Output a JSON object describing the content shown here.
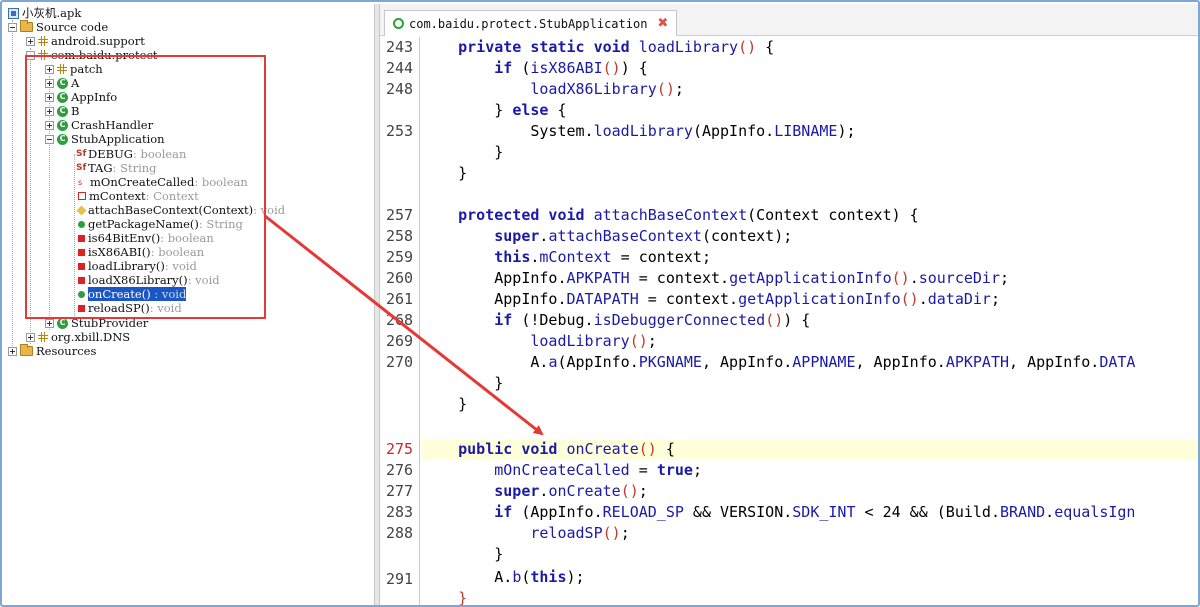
{
  "window": {
    "tree": {
      "root": "小灰机.apk",
      "source_code": "Source code",
      "android_support": "android.support",
      "pkg": "com.baidu.protect",
      "patch": "patch",
      "classA": "A",
      "appinfo": "AppInfo",
      "classB": "B",
      "crash": "CrashHandler",
      "stubapp": "StubApplication",
      "members": [
        {
          "name": "DEBUG",
          "type": " : boolean"
        },
        {
          "name": "TAG",
          "type": " : String"
        },
        {
          "name": "mOnCreateCalled",
          "type": " : boolean"
        },
        {
          "name": "mContext",
          "type": " : Context"
        },
        {
          "name": "attachBaseContext(Context)",
          "type": " : void"
        },
        {
          "name": "getPackageName()",
          "type": " : String"
        },
        {
          "name": "is64BitEnv()",
          "type": " : boolean"
        },
        {
          "name": "isX86ABI()",
          "type": " : boolean"
        },
        {
          "name": "loadLibrary()",
          "type": " : void"
        },
        {
          "name": "loadX86Library()",
          "type": " : void"
        },
        {
          "name": "onCreate()",
          "type": " : void"
        },
        {
          "name": "reloadSP()",
          "type": " : void"
        }
      ],
      "stubprovider": "StubProvider",
      "xbill": "org.xbill.DNS",
      "resources": "Resources"
    },
    "editor": {
      "tab_title": "com.baidu.protect.StubApplication",
      "tab_close": "✖",
      "line_numbers": [
        "243",
        "244",
        "248",
        "",
        "253",
        "",
        "",
        "",
        "257",
        "258",
        "259",
        "260",
        "261",
        "268",
        "269",
        "270",
        "",
        "",
        "",
        "275",
        "276",
        "277",
        "283",
        "288",
        "",
        "291",
        ""
      ],
      "highlight_line": "275"
    }
  },
  "colors": {
    "keyword": "#1a1aa6",
    "annotation_red": "#e53935",
    "selection": "#1a56c6",
    "current_line": "#ffffd9"
  }
}
